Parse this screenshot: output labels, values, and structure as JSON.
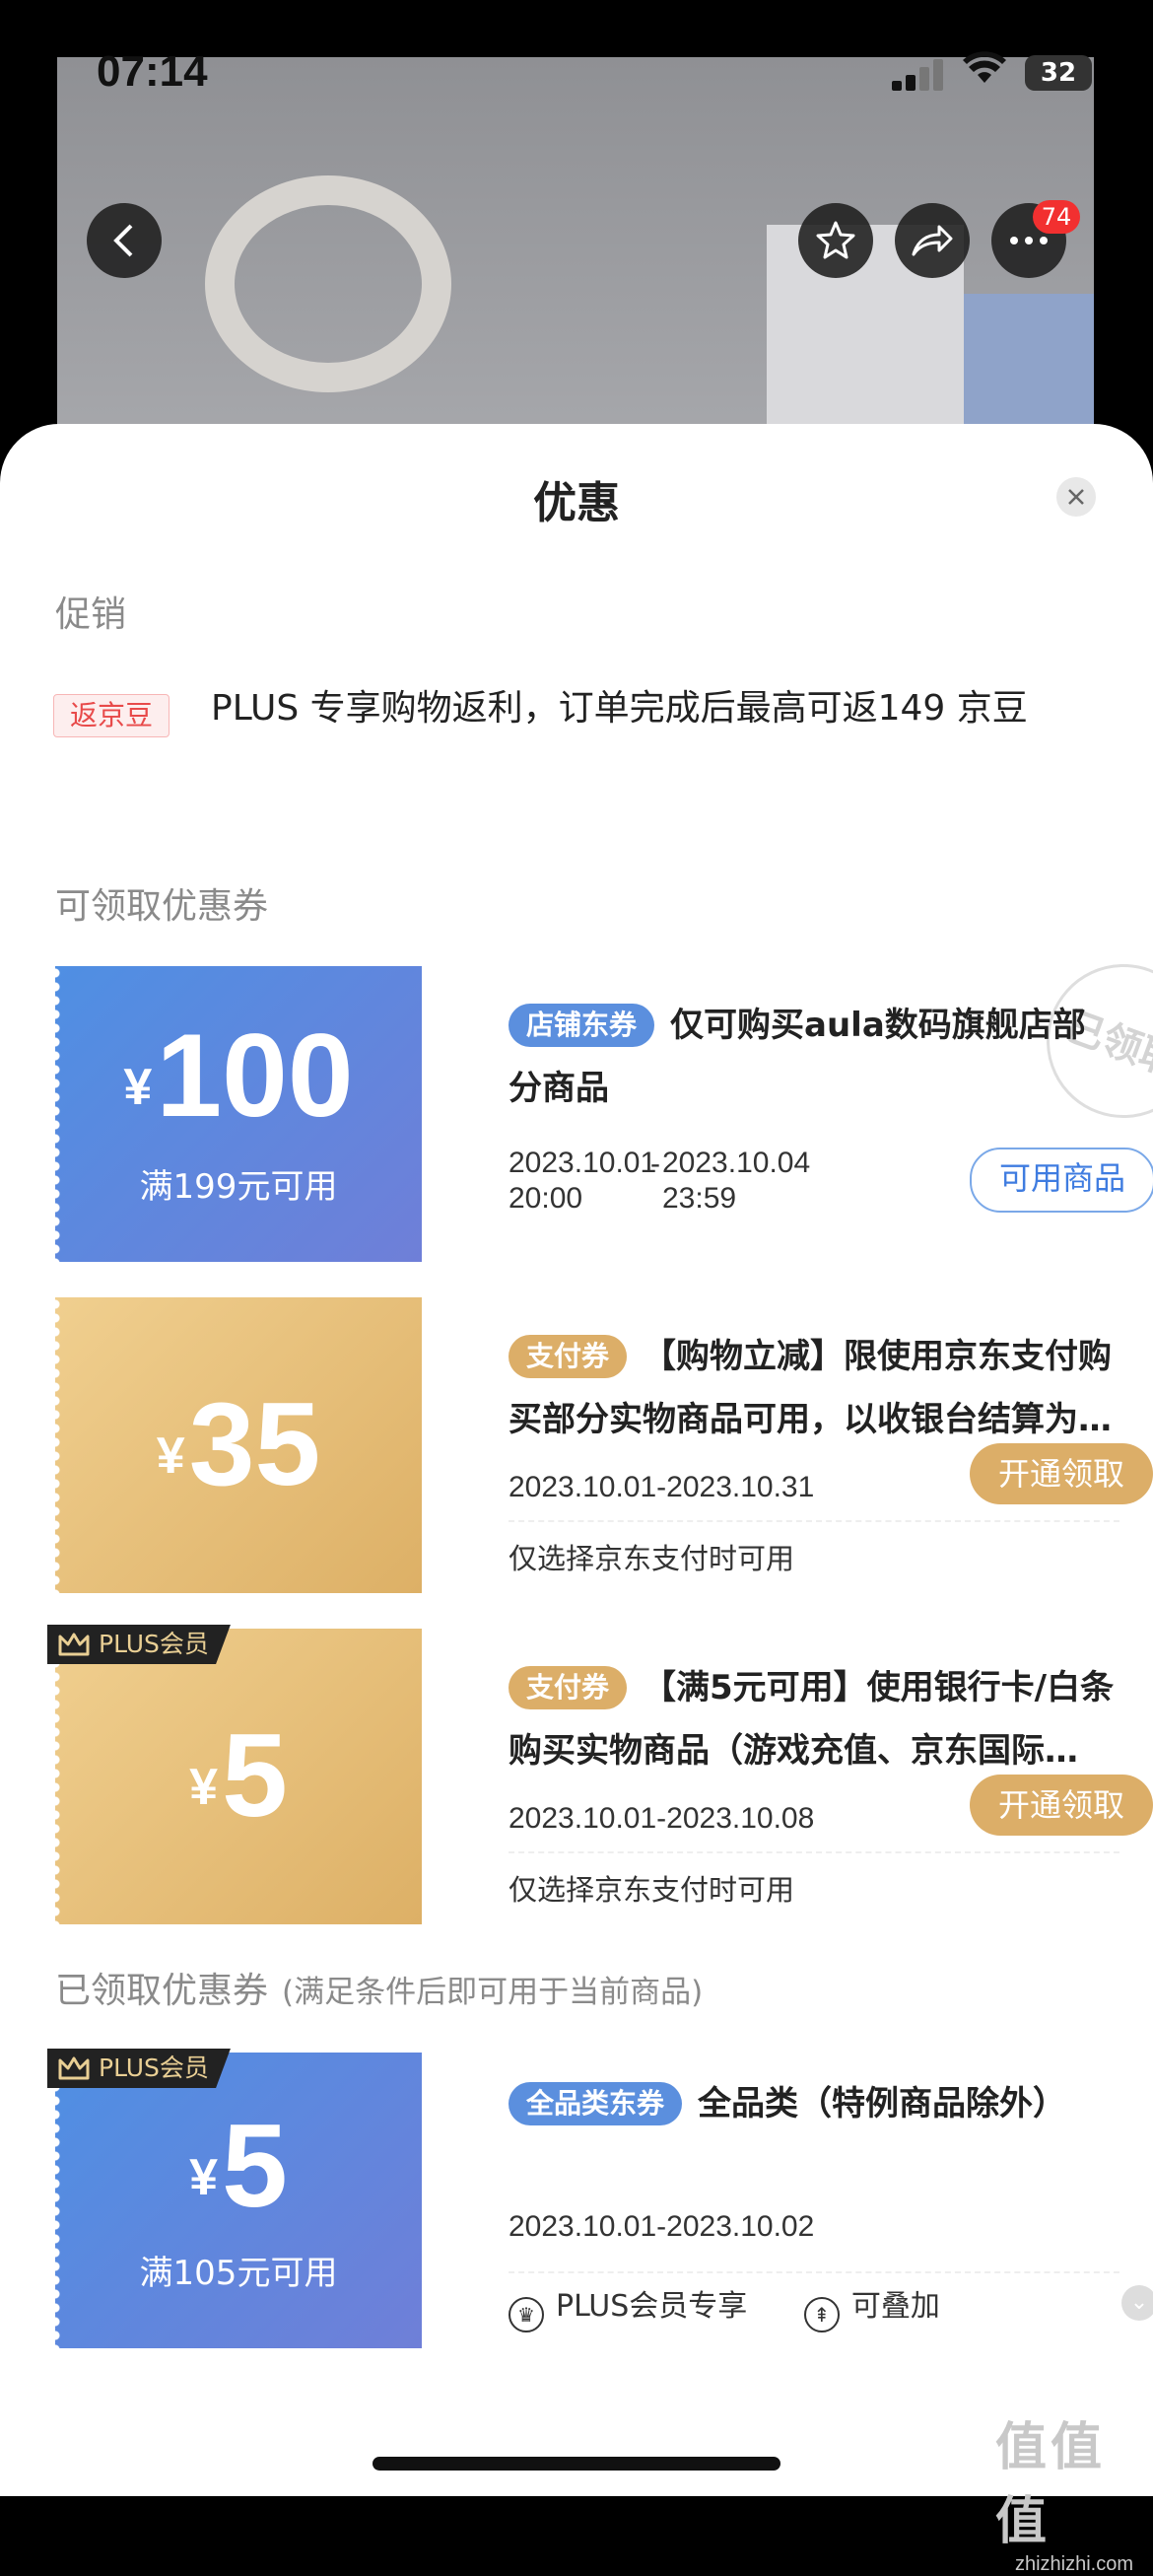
{
  "status_bar": {
    "time": "07:14",
    "battery": "32"
  },
  "nav": {
    "badge_count": "74"
  },
  "sheet": {
    "title": "优惠"
  },
  "promotion": {
    "section_label": "促销",
    "tag": "返京豆",
    "text": "PLUS 专享购物返利，订单完成后最高可返149 京豆"
  },
  "available_coupons": {
    "section_label": "可领取优惠券",
    "items": [
      {
        "currency": "¥",
        "amount": "100",
        "condition": "满199元可用",
        "tag": "店铺东券",
        "description": "仅可购买aula数码旗舰店部分商品",
        "date_start": "2023.10.01 20:00",
        "date_sep": "-",
        "date_end": "2023.10.04 23:59",
        "button": "可用商品",
        "stamp": "已领取"
      },
      {
        "currency": "¥",
        "amount": "35",
        "tag": "支付券",
        "description": "【购物立减】限使用京东支付购买部分实物商品可用，以收银台结算为…",
        "date": "2023.10.01-2023.10.31",
        "button": "开通领取",
        "note": "仅选择京东支付时可用"
      },
      {
        "plus_label": "PLUS会员",
        "currency": "¥",
        "amount": "5",
        "tag": "支付券",
        "description": "【满5元可用】使用银行卡/白条购买实物商品（游戏充值、京东国际…",
        "date": "2023.10.01-2023.10.08",
        "button": "开通领取",
        "note": "仅选择京东支付时可用"
      }
    ]
  },
  "received_coupons": {
    "section_label": "已领取优惠券",
    "section_note": "(满足条件后即可用于当前商品)",
    "items": [
      {
        "plus_label": "PLUS会员",
        "currency": "¥",
        "amount": "5",
        "condition": "满105元可用",
        "tag": "全品类东券",
        "description": "全品类（特例商品除外）",
        "date": "2023.10.01-2023.10.02",
        "feature1": "PLUS会员专享",
        "feature2": "可叠加"
      }
    ]
  },
  "watermark": {
    "logo": "值值值",
    "site": "zhizhizhi.com"
  }
}
